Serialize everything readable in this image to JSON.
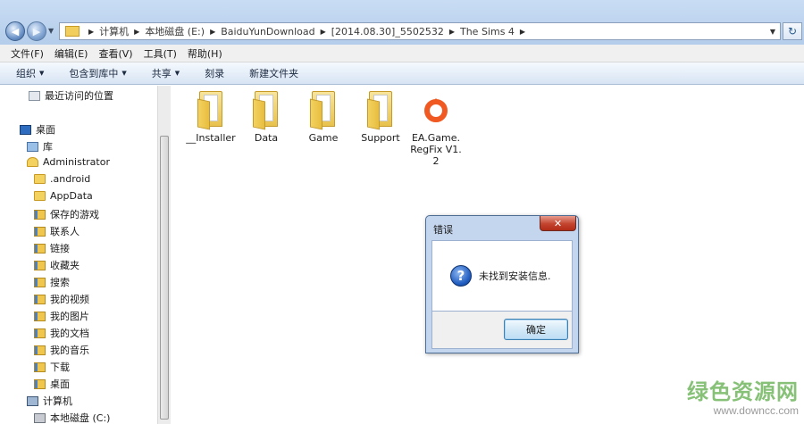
{
  "address_bar": {
    "crumbs": [
      "计算机",
      "本地磁盘 (E:)",
      "BaiduYunDownload",
      "[2014.08.30]_5502532",
      "The Sims 4"
    ]
  },
  "menubar": [
    "文件(F)",
    "编辑(E)",
    "查看(V)",
    "工具(T)",
    "帮助(H)"
  ],
  "toolbar": {
    "organize": "组织",
    "include_in_library": "包含到库中",
    "share": "共享",
    "burn": "刻录",
    "new_folder": "新建文件夹"
  },
  "nav_tree": [
    {
      "label": "最近访问的位置",
      "icon": "recent-icon"
    },
    {
      "label": "桌面",
      "icon": "desktop-icon"
    },
    {
      "label": "库",
      "icon": "library-icon"
    },
    {
      "label": "Administrator",
      "icon": "user-folder-icon"
    },
    {
      "label": ".android",
      "icon": "folder-icon"
    },
    {
      "label": "AppData",
      "icon": "folder-icon"
    },
    {
      "label": "保存的游戏",
      "icon": "saved-games-icon"
    },
    {
      "label": "联系人",
      "icon": "contacts-icon"
    },
    {
      "label": "链接",
      "icon": "links-icon"
    },
    {
      "label": "收藏夹",
      "icon": "favorites-icon"
    },
    {
      "label": "搜索",
      "icon": "searches-icon"
    },
    {
      "label": "我的视频",
      "icon": "videos-icon"
    },
    {
      "label": "我的图片",
      "icon": "pictures-icon"
    },
    {
      "label": "我的文档",
      "icon": "documents-icon"
    },
    {
      "label": "我的音乐",
      "icon": "music-icon"
    },
    {
      "label": "下载",
      "icon": "downloads-icon"
    },
    {
      "label": "桌面",
      "icon": "desktop-folder-icon"
    },
    {
      "label": "计算机",
      "icon": "computer-icon"
    },
    {
      "label": "本地磁盘 (C:)",
      "icon": "disk-icon"
    }
  ],
  "files": [
    {
      "name": "__Installer",
      "type": "folder"
    },
    {
      "name": "Data",
      "type": "folder"
    },
    {
      "name": "Game",
      "type": "folder"
    },
    {
      "name": "Support",
      "type": "folder"
    },
    {
      "name": "EA.Game.RegFix V1.2",
      "type": "origin-app"
    }
  ],
  "dialog": {
    "title": "错误",
    "close_label": "✕",
    "message": "未找到安装信息.",
    "ok_label": "确定",
    "icon": "question-icon"
  },
  "watermark": {
    "cn": "绿色资源网",
    "url": "www.downcc.com"
  },
  "colors": {
    "origin_orange": "#f05a22",
    "dialog_frame": "#c4d6ee",
    "close_red": "#c3442f"
  }
}
